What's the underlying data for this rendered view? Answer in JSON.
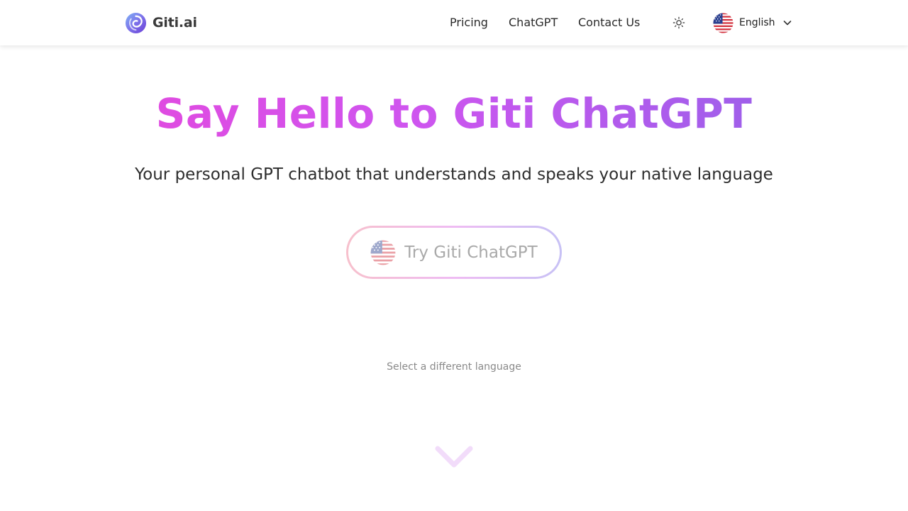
{
  "header": {
    "brand_name": "Giti.ai",
    "nav": {
      "pricing": "Pricing",
      "chatgpt": "ChatGPT",
      "contact": "Contact Us"
    },
    "language": {
      "selected": "English",
      "flag": "us-flag-icon"
    },
    "theme_icon": "sun-icon"
  },
  "hero": {
    "title": "Say Hello to Giti ChatGPT",
    "subtitle": "Your personal GPT chatbot that understands and speaks your native language",
    "cta_label": "Try Giti ChatGPT",
    "select_language": "Select a different language",
    "scroll_icon": "chevron-down-icon"
  },
  "colors": {
    "title_gradient_start": "#e945d8",
    "title_gradient_end": "#8a63e8",
    "cta_border_start": "#f7c0cc",
    "cta_border_end": "#c7c1f5",
    "scroll_chevron": "#f2dcfa"
  }
}
